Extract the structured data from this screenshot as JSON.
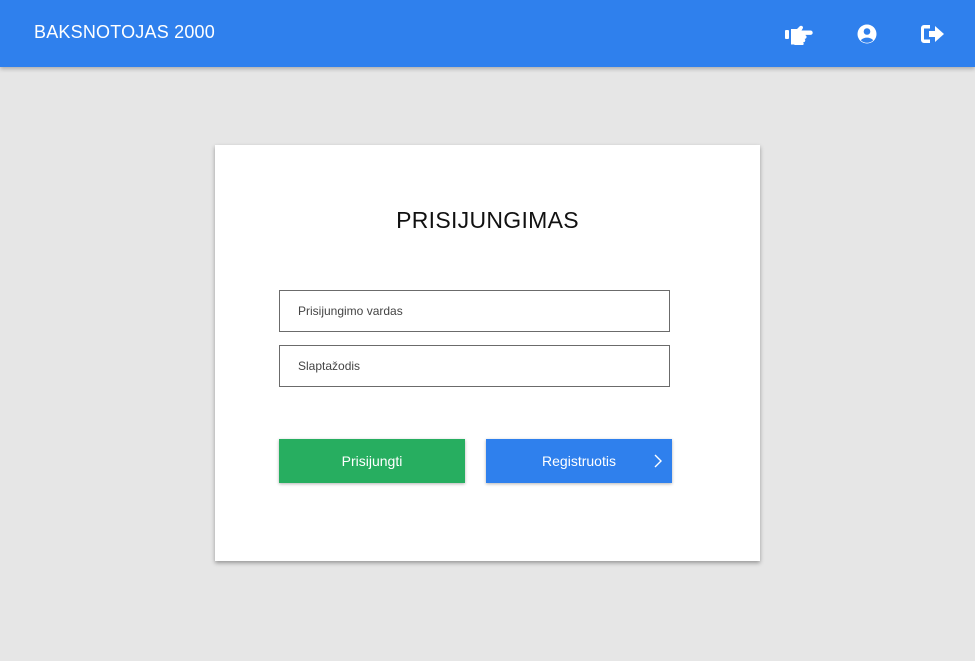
{
  "header": {
    "app_title": "BAKSNOTOJAS 2000",
    "icons": [
      "pointing-hand-icon",
      "user-circle-icon",
      "logout-icon"
    ],
    "background_color": "#2f80ed"
  },
  "login_card": {
    "title": "PRISIJUNGIMAS",
    "username_placeholder": "Prisijungimo vardas",
    "password_placeholder": "Slaptažodis",
    "login_button_label": "Prisijungti",
    "register_button_label": "Registruotis",
    "login_button_color": "#27ae60",
    "register_button_color": "#2f80ed",
    "register_button_icon": "chevron-right-icon"
  }
}
